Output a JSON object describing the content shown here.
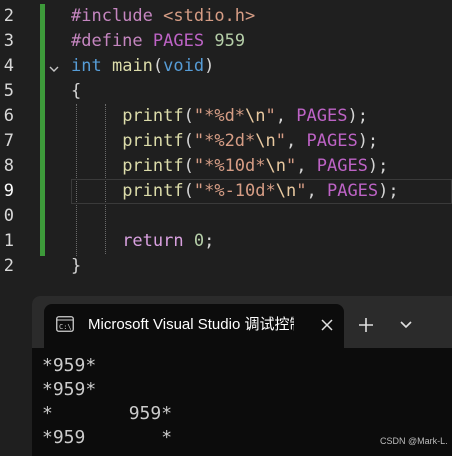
{
  "editor": {
    "line_numbers": [
      "2",
      "3",
      "4",
      "5",
      "6",
      "7",
      "8",
      "9",
      "0",
      "1",
      "2"
    ],
    "lines": {
      "l2": {
        "directive": "#include",
        "header": "<stdio.h>"
      },
      "l3": {
        "directive": "#define",
        "macro": "PAGES",
        "value": "959"
      },
      "l4": {
        "ret_type": "int",
        "name": "main",
        "open": "(",
        "param": "void",
        "close": ")"
      },
      "l5": {
        "brace": "{"
      },
      "l6": {
        "fn": "printf",
        "open": "(",
        "fmt_a": "\"*%d*",
        "esc": "\\n",
        "fmt_b": "\"",
        "sep": ", ",
        "arg": "PAGES",
        "end": ");"
      },
      "l7": {
        "fn": "printf",
        "open": "(",
        "fmt_a": "\"*%2d*",
        "esc": "\\n",
        "fmt_b": "\"",
        "sep": ", ",
        "arg": "PAGES",
        "end": ");"
      },
      "l8": {
        "fn": "printf",
        "open": "(",
        "fmt_a": "\"*%10d*",
        "esc": "\\n",
        "fmt_b": "\"",
        "sep": ", ",
        "arg": "PAGES",
        "end": ");"
      },
      "l9": {
        "fn": "printf",
        "open": "(",
        "fmt_a": "\"*%-10d*",
        "esc": "\\n",
        "fmt_b": "\"",
        "sep": ", ",
        "arg": "PAGES",
        "end": ");"
      },
      "l11": {
        "kw": "return",
        "value": "0",
        "end": ";"
      },
      "l12": {
        "brace": "}"
      }
    }
  },
  "terminal": {
    "tab_title": "Microsoft Visual Studio 调试控制台",
    "output": [
      "*959*",
      "*959*",
      "*       959*",
      "*959       *"
    ]
  },
  "watermark": "CSDN @Mark-L.",
  "colors": {
    "editor_bg": "#1f1f1f",
    "terminal_bg": "#0c0c0c",
    "titlebar_bg": "#2b2b2b",
    "change_bar": "#3d9a3a",
    "keyword": "#569cd6",
    "function": "#dcdcaa",
    "string": "#d69d85",
    "macro": "#bd63c5",
    "number": "#b5cea8",
    "control": "#d8a0df"
  },
  "icons": {
    "fold": "chevron-down-icon",
    "tab": "terminal-icon",
    "close": "close-icon",
    "new_tab": "plus-icon",
    "dropdown": "chevron-down-icon"
  }
}
